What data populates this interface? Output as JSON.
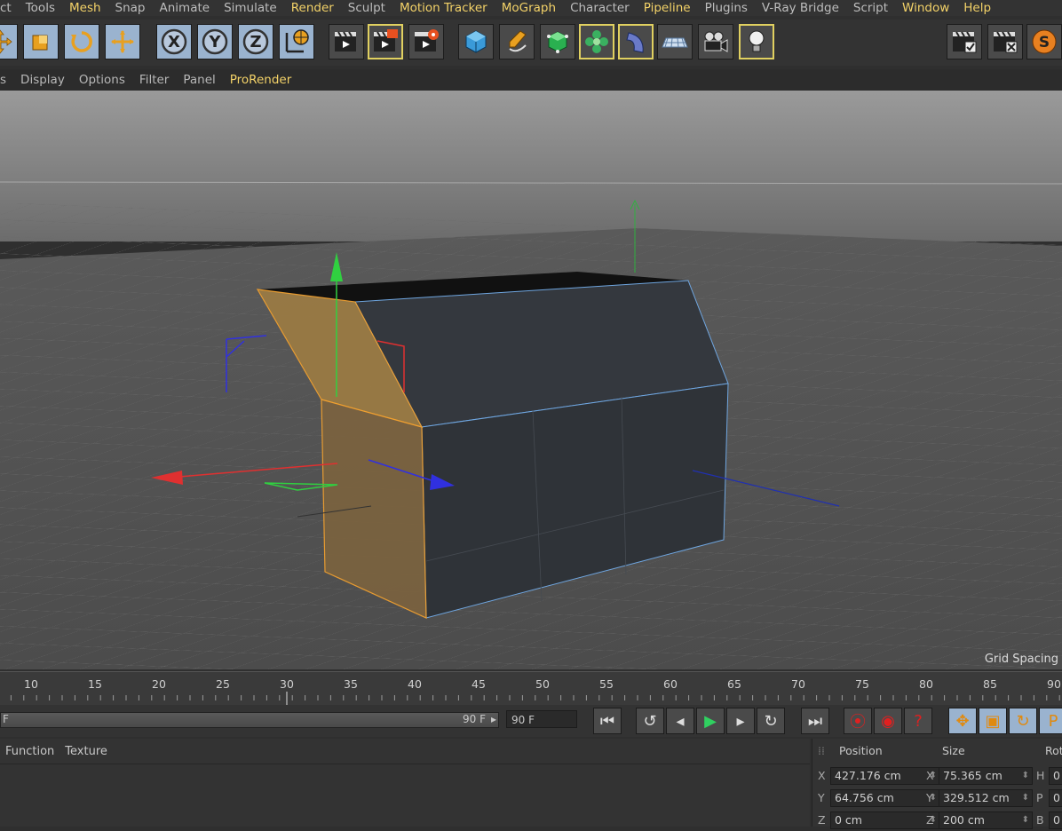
{
  "menu": [
    {
      "label": "ct",
      "hl": false
    },
    {
      "label": "Tools",
      "hl": false
    },
    {
      "label": "Mesh",
      "hl": true
    },
    {
      "label": "Snap",
      "hl": false
    },
    {
      "label": "Animate",
      "hl": false
    },
    {
      "label": "Simulate",
      "hl": false
    },
    {
      "label": "Render",
      "hl": true
    },
    {
      "label": "Sculpt",
      "hl": false
    },
    {
      "label": "Motion Tracker",
      "hl": true
    },
    {
      "label": "MoGraph",
      "hl": true
    },
    {
      "label": "Character",
      "hl": false
    },
    {
      "label": "Pipeline",
      "hl": true
    },
    {
      "label": "Plugins",
      "hl": false
    },
    {
      "label": "V-Ray Bridge",
      "hl": false
    },
    {
      "label": "Script",
      "hl": false
    },
    {
      "label": "Window",
      "hl": true
    },
    {
      "label": "Help",
      "hl": true
    }
  ],
  "viewport_menu": [
    {
      "label": "s",
      "hl": false
    },
    {
      "label": "Display",
      "hl": false
    },
    {
      "label": "Options",
      "hl": false
    },
    {
      "label": "Filter",
      "hl": false
    },
    {
      "label": "Panel",
      "hl": false
    },
    {
      "label": "ProRender",
      "hl": true
    }
  ],
  "toolbar": {
    "axis_x": "X",
    "axis_y": "Y",
    "axis_z": "Z"
  },
  "viewport": {
    "grid_label": "Grid Spacing"
  },
  "timeline": {
    "ticks": [
      "10",
      "15",
      "20",
      "25",
      "30",
      "35",
      "40",
      "45",
      "50",
      "55",
      "60",
      "65",
      "70",
      "75",
      "80",
      "85",
      "90"
    ],
    "slider_start": "F",
    "slider_end": "90 F",
    "end_frame": "90 F"
  },
  "lower_tabs": [
    "Function",
    "Texture"
  ],
  "coords": {
    "headers": {
      "position": "Position",
      "size": "Size",
      "rotation": "Rot"
    },
    "rows": [
      {
        "axis": "X",
        "pos": "427.176 cm",
        "size_axis": "X",
        "size": "75.365 cm",
        "rot_axis": "H",
        "rot": "0"
      },
      {
        "axis": "Y",
        "pos": "64.756 cm",
        "size_axis": "Y",
        "size": "329.512 cm",
        "rot_axis": "P",
        "rot": "0"
      },
      {
        "axis": "Z",
        "pos": "0 cm",
        "size_axis": "Z",
        "size": "200 cm",
        "rot_axis": "B",
        "rot": "0"
      }
    ]
  },
  "colors": {
    "accent": "#f3d268",
    "selection": "#e8a020",
    "axis_x": "#e02020",
    "axis_y": "#20c040",
    "axis_z": "#2030e0"
  }
}
